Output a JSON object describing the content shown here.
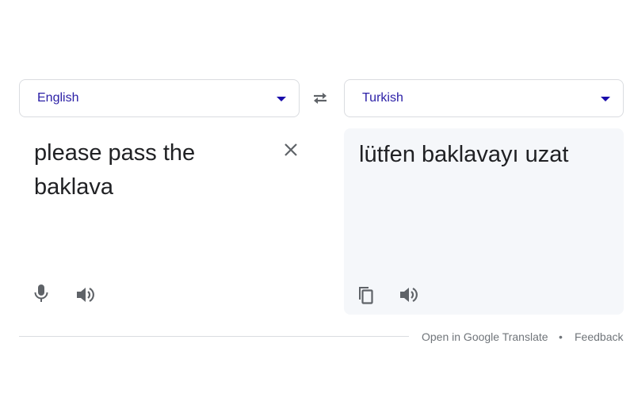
{
  "source_language": {
    "label": "English"
  },
  "target_language": {
    "label": "Turkish"
  },
  "source_text": "please pass the baklava",
  "translated_text": "lütfen baklavayı uzat",
  "icons": {
    "swap": "swap-languages-icon",
    "clear": "close-icon",
    "mic": "microphone-icon",
    "listen": "speaker-icon",
    "copy": "copy-icon"
  },
  "footer": {
    "open_link": "Open in Google Translate",
    "separator": "•",
    "feedback": "Feedback"
  },
  "colors": {
    "accent": "#1a0dab",
    "icon": "#5f6368",
    "panel_bg": "#f5f7fa"
  }
}
